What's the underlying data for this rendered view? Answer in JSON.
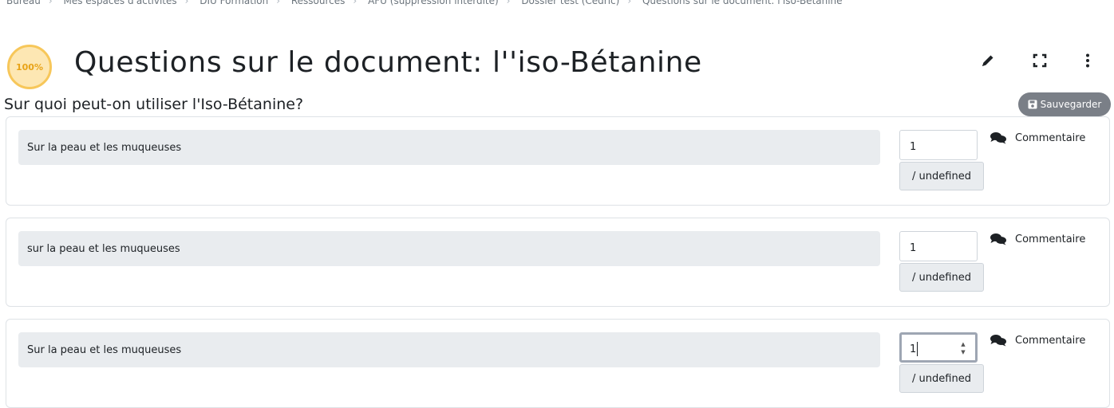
{
  "breadcrumb": [
    "Bureau",
    "Mes espaces d'activités",
    "DIU Formation",
    "Ressources",
    "AFU (suppression interdite)",
    "Dossier test (Cédric)",
    "Questions sur le document: l'iso-Bétanine"
  ],
  "header": {
    "progress": "100%",
    "title": "Questions sur le document: l''iso-Bétanine",
    "icons": [
      "pencil-icon",
      "fullscreen-icon",
      "more-vertical-icon"
    ]
  },
  "question": {
    "text": "Sur quoi peut-on utiliser l'Iso-Bétanine?",
    "save_label": "Sauvegarder"
  },
  "answers": [
    {
      "text": "Sur la peau et les muqueuses",
      "score": "1",
      "max": "/ undefined",
      "comment_label": "Commentaire"
    },
    {
      "text": "sur la peau et les muqueuses",
      "score": "1",
      "max": "/ undefined",
      "comment_label": "Commentaire"
    },
    {
      "text": "Sur la peau et les muqueuses",
      "score": "1",
      "max": "/ undefined",
      "comment_label": "Commentaire"
    }
  ],
  "colors": {
    "badge_bg": "#fde7b3",
    "badge_border": "#f7c75a",
    "save_button": "#7a7f87"
  }
}
